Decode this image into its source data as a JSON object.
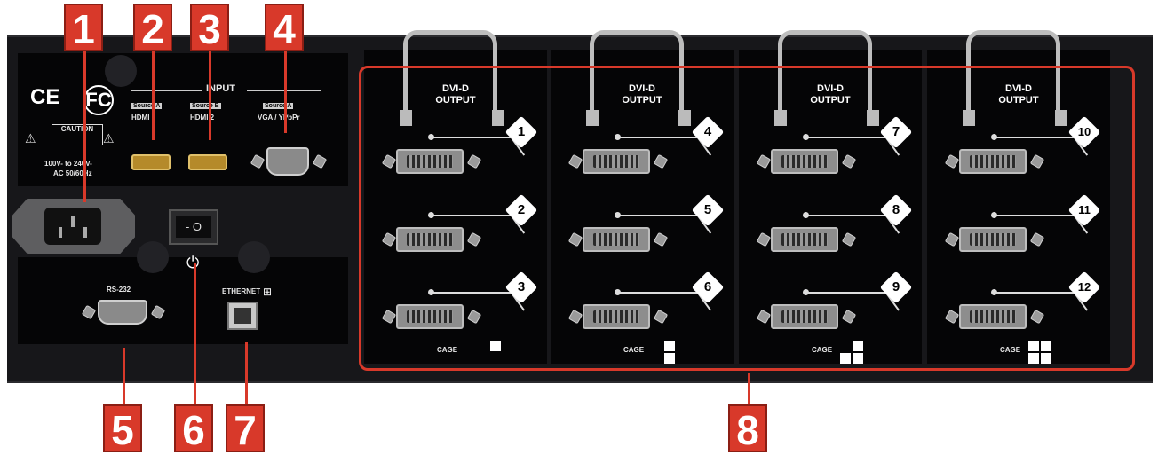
{
  "callouts": [
    "1",
    "2",
    "3",
    "4",
    "5",
    "6",
    "7",
    "8"
  ],
  "left_panel": {
    "ce_mark": "CE",
    "fc_mark": "FC",
    "caution_label": "CAUTION",
    "voltage_line1": "100V- to 240V-",
    "voltage_line2": "AC 50/60Hz",
    "input_label": "INPUT",
    "source_tag_1": "Source A",
    "source_tag_2": "Source B",
    "source_tag_3": "Source A",
    "hdmi1_label": "HDMI 1",
    "hdmi2_label": "HDMI 2",
    "vga_label": "VGA / YPbPr",
    "rs232_label": "RS-232",
    "ethernet_label": "ETHERNET",
    "switch_glyph": "- O",
    "power_glyph": "⏻"
  },
  "cages": [
    {
      "title_line1": "DVI-D",
      "title_line2": "OUTPUT",
      "ports": [
        "1",
        "2",
        "3"
      ],
      "cage_label": "CAGE"
    },
    {
      "title_line1": "DVI-D",
      "title_line2": "OUTPUT",
      "ports": [
        "4",
        "5",
        "6"
      ],
      "cage_label": "CAGE"
    },
    {
      "title_line1": "DVI-D",
      "title_line2": "OUTPUT",
      "ports": [
        "7",
        "8",
        "9"
      ],
      "cage_label": "CAGE"
    },
    {
      "title_line1": "DVI-D",
      "title_line2": "OUTPUT",
      "ports": [
        "10",
        "11",
        "12"
      ],
      "cage_label": "CAGE"
    }
  ],
  "colors": {
    "callout": "#d8392a",
    "chassis": "#17171a",
    "plate": "#050506"
  }
}
